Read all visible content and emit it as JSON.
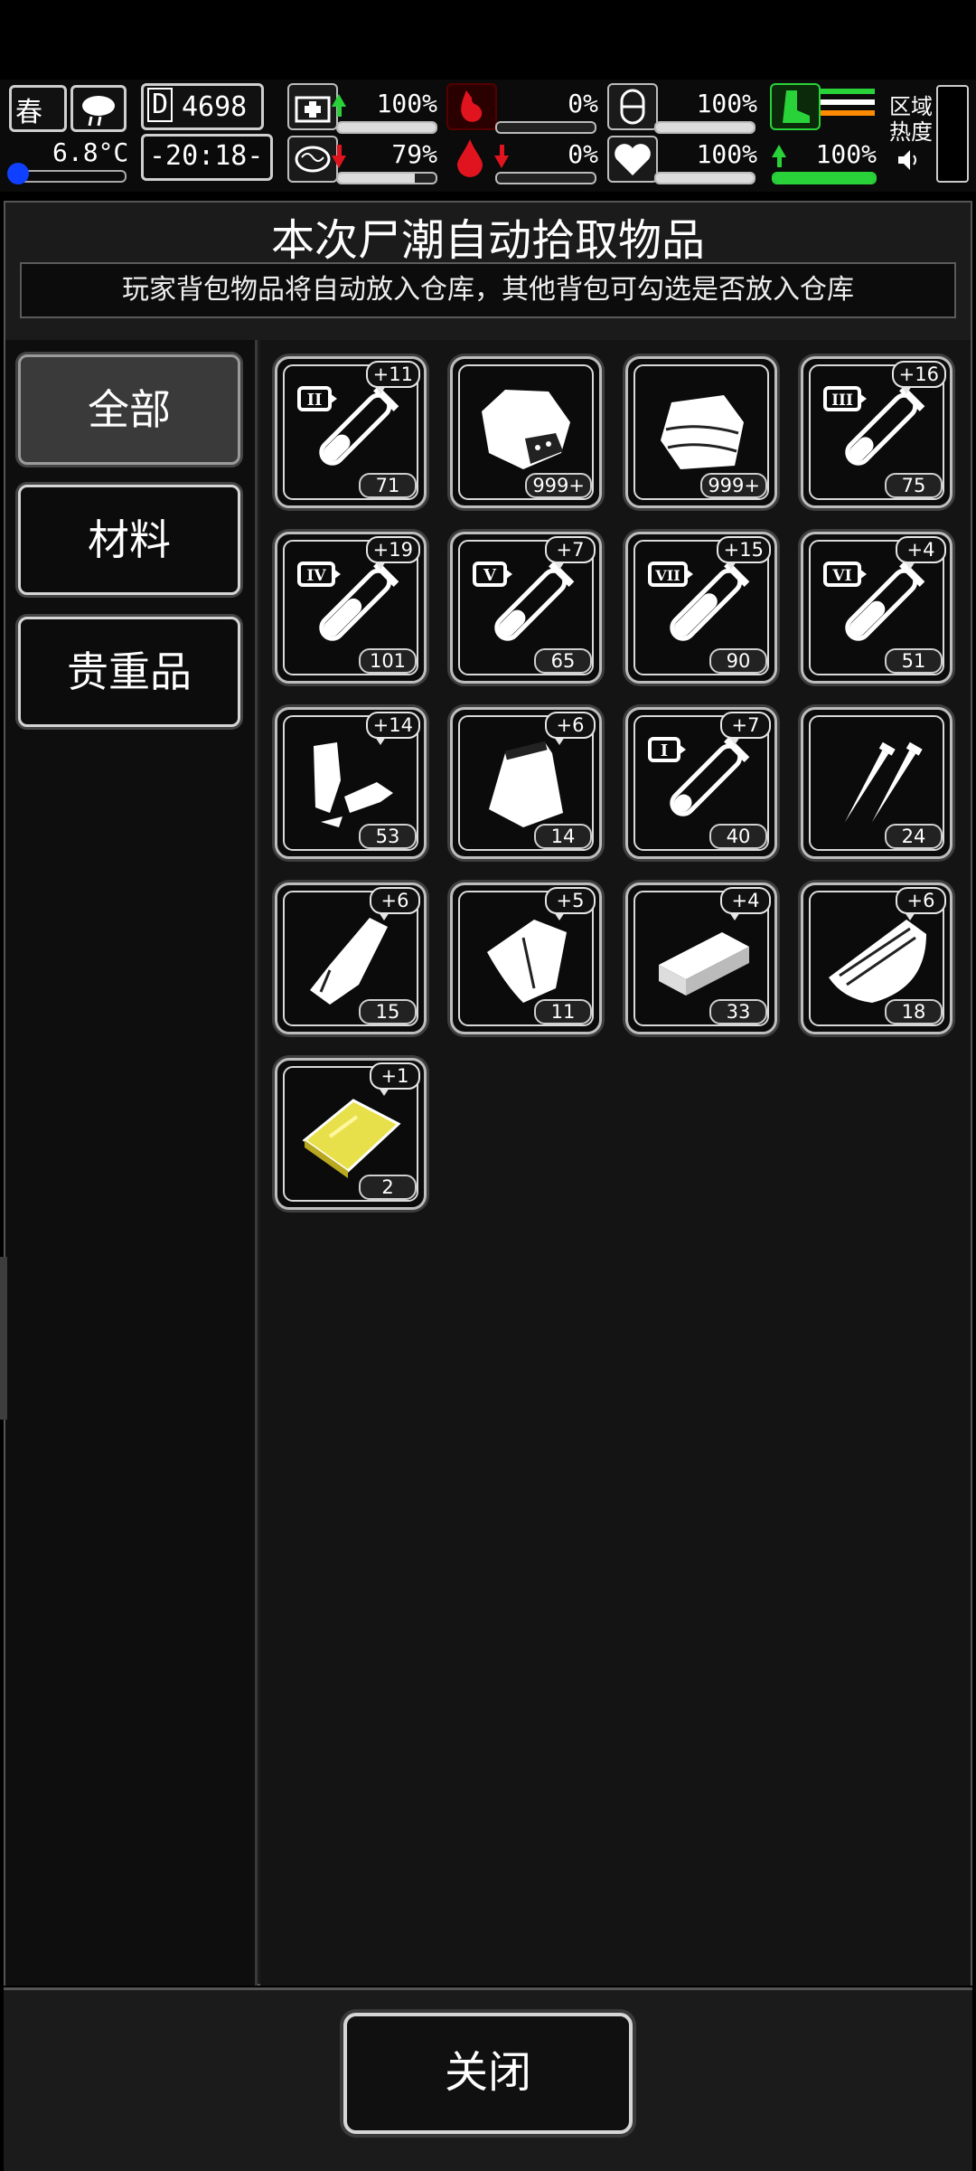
{
  "hud": {
    "season": "春",
    "temperature": "6.8°C",
    "day_prefix": "D",
    "day": "4698",
    "time": "-20:18-",
    "zone_heat_label": "区域\n热度",
    "stats": [
      {
        "name": "health",
        "value": "100%",
        "trend": "up"
      },
      {
        "name": "hunger",
        "value": "0%",
        "trend": "none"
      },
      {
        "name": "stamina",
        "value": "100%",
        "trend": "none"
      },
      {
        "name": "sanity",
        "value": "79%",
        "trend": "down"
      },
      {
        "name": "bleeding",
        "value": "0%",
        "trend": "down"
      },
      {
        "name": "mood",
        "value": "100%",
        "trend": "none"
      },
      {
        "name": "speed",
        "value": "100%",
        "trend": "up"
      }
    ],
    "colors": {
      "good": "#2ad23a",
      "bad": "#e0141e",
      "stripe_orange": "#ff8c00"
    }
  },
  "panel": {
    "title": "本次尸潮自动拾取物品",
    "subtitle": "玩家背包物品将自动放入仓库，其他背包可勾选是否放入仓库"
  },
  "categories": [
    {
      "label": "全部",
      "active": true
    },
    {
      "label": "材料",
      "active": false
    },
    {
      "label": "贵重品",
      "active": false
    }
  ],
  "items": [
    {
      "icon": "test-tube-ii-icon",
      "tier": "II",
      "bonus": "+11",
      "count": "71"
    },
    {
      "icon": "raw-meat-icon",
      "bonus": "",
      "count": "999+"
    },
    {
      "icon": "cloth-icon",
      "bonus": "",
      "count": "999+"
    },
    {
      "icon": "test-tube-iii-icon",
      "tier": "III",
      "bonus": "+16",
      "count": "75"
    },
    {
      "icon": "test-tube-iv-icon",
      "tier": "IV",
      "bonus": "+19",
      "count": "101"
    },
    {
      "icon": "test-tube-v-icon",
      "tier": "V",
      "bonus": "+7",
      "count": "65"
    },
    {
      "icon": "test-tube-vii-icon",
      "tier": "VII",
      "bonus": "+15",
      "count": "90"
    },
    {
      "icon": "test-tube-vi-icon",
      "tier": "VI",
      "bonus": "+4",
      "count": "51"
    },
    {
      "icon": "scrap-metal-icon",
      "bonus": "+14",
      "count": "53"
    },
    {
      "icon": "pouch-icon",
      "bonus": "+6",
      "count": "14"
    },
    {
      "icon": "test-tube-i-icon",
      "tier": "I",
      "bonus": "+7",
      "count": "40"
    },
    {
      "icon": "nails-icon",
      "bonus": "",
      "count": "24"
    },
    {
      "icon": "rag-icon",
      "bonus": "+6",
      "count": "15"
    },
    {
      "icon": "leather-icon",
      "bonus": "+5",
      "count": "11"
    },
    {
      "icon": "brick-icon",
      "bonus": "+4",
      "count": "33"
    },
    {
      "icon": "wood-planks-icon",
      "bonus": "+6",
      "count": "18"
    },
    {
      "icon": "gold-plate-icon",
      "bonus": "+1",
      "count": "2"
    }
  ],
  "footer": {
    "close_label": "关闭"
  }
}
